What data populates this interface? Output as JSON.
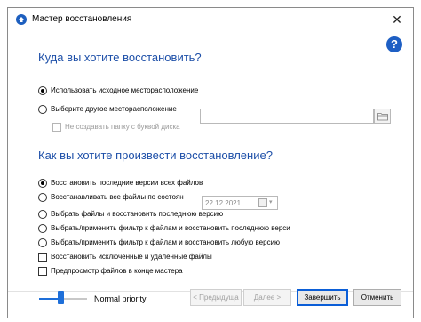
{
  "window": {
    "title": "Мастер восстановления",
    "close_symbol": "✕",
    "help_symbol": "?"
  },
  "location_section": {
    "heading": "Куда вы хотите восстановить?",
    "options": [
      {
        "label": "Использовать исходное месторасположение",
        "checked": true
      },
      {
        "label": "Выберите другое месторасположение",
        "checked": false
      }
    ],
    "path_value": "",
    "no_drive_folder_label": "Не создавать папку с буквой диска"
  },
  "restore_section": {
    "heading": "Как вы хотите произвести восстановление?",
    "options": [
      {
        "label": "Восстановить последние версии всех файлов",
        "checked": true
      },
      {
        "label": "Восстанавливать все файлы по состоян",
        "checked": false
      },
      {
        "label": "Выбрать файлы и восстановить последнюю версию",
        "checked": false
      },
      {
        "label": "Выбрать/применить фильтр к файлам и восстановить последнюю верси",
        "checked": false
      },
      {
        "label": "Выбрать/применить фильтр к файлам и восстановить любую версию",
        "checked": false
      }
    ],
    "date_value": "22.12.2021",
    "checkboxes": [
      {
        "label": "Восстановить исключенные и удаленные файлы",
        "checked": false
      },
      {
        "label": "Предпросмотр файлов в конце мастера",
        "checked": false
      }
    ]
  },
  "footer": {
    "priority_label": "Normal priority",
    "priority_level": 0.45,
    "buttons": {
      "back": "< Предыдуща",
      "next": "Далее >",
      "finish": "Завершить",
      "cancel": "Отменить"
    }
  },
  "icons": [
    "app-icon",
    "close-icon",
    "help-icon",
    "folder-icon",
    "calendar-icon"
  ],
  "colors": {
    "heading": "#1d4fa8",
    "accent": "#1e6fd9",
    "help_icon": "#1e5fc4"
  }
}
